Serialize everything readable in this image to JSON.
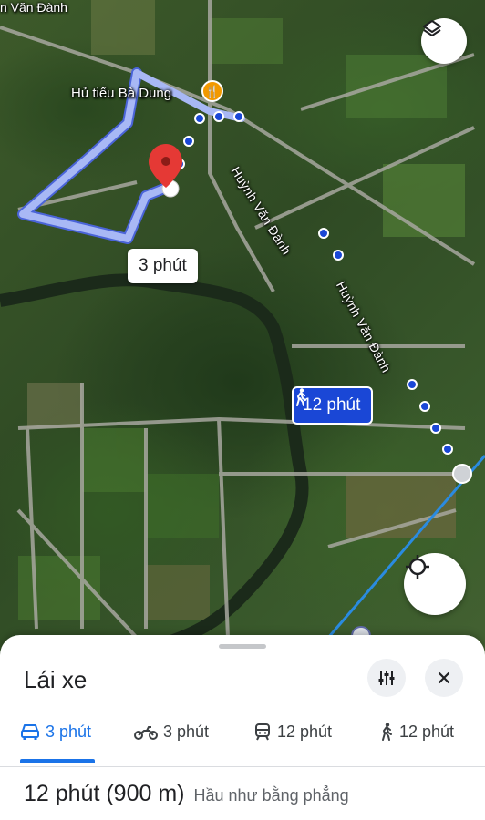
{
  "map": {
    "poi_label": "Hủ tiếu Bà Dung",
    "road_label_top": "n Văn Đành",
    "road_label_1": "Huỳnh Văn Đành",
    "road_label_2": "Huỳnh Văn Đành",
    "drive_time_bubble": "3 phút",
    "walk_time_bubble": "12 phút",
    "route_color": "#a8b8f5",
    "walk_route_color": "#1a47d6",
    "poi_color": "#f29900",
    "pin_color": "#e53935"
  },
  "buttons": {
    "layers_icon": "layers-icon",
    "locate_icon": "crosshair-icon"
  },
  "sheet": {
    "title": "Lái xe",
    "modes": [
      {
        "icon": "car-icon",
        "label": "3 phút",
        "active": true
      },
      {
        "icon": "motorbike-icon",
        "label": "3 phút",
        "active": false
      },
      {
        "icon": "transit-icon",
        "label": "12 phút",
        "active": false
      },
      {
        "icon": "walk-icon",
        "label": "12 phút",
        "active": false
      }
    ],
    "summary_main": "12 phút (900 m)",
    "summary_sub": "Hầu như bằng phẳng",
    "accent_color": "#1a73e8"
  }
}
